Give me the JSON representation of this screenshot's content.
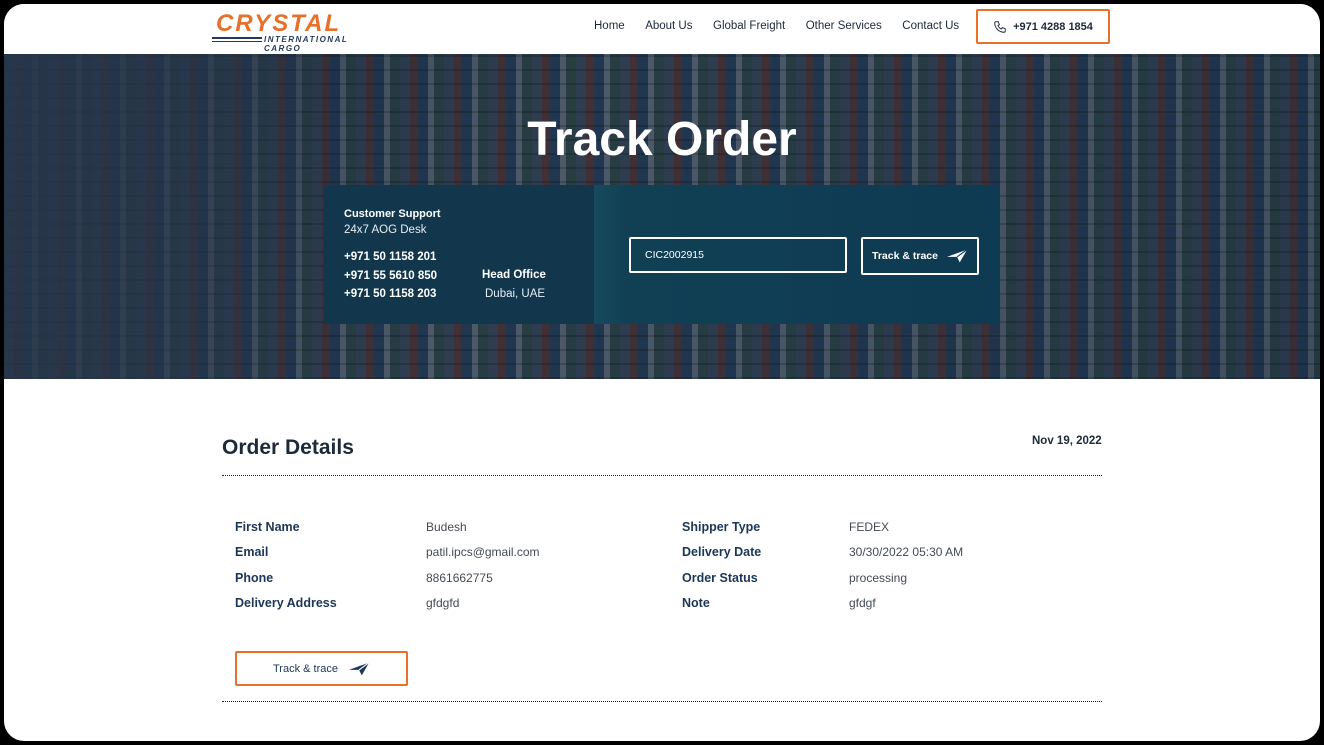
{
  "brand": {
    "name": "CRYSTAL",
    "tagline": "INTERNATIONAL CARGO",
    "accent": "#e8702a",
    "navy": "#1c3658"
  },
  "nav": {
    "items": [
      {
        "label": "Home"
      },
      {
        "label": "About Us"
      },
      {
        "label": "Global Freight"
      },
      {
        "label": "Other Services"
      },
      {
        "label": "Contact Us"
      }
    ],
    "phone_label": "+971 4288 1854",
    "phone_icon": "phone-icon"
  },
  "hero": {
    "title": "Track Order",
    "support": {
      "heading": "Customer Support",
      "subheading": "24x7 AOG Desk",
      "phones": [
        "+971 50 1158 201",
        "+971 55 5610 850",
        "+971 50 1158 203"
      ],
      "head_office_label": "Head Office",
      "head_office_value": "Dubai, UAE"
    },
    "track": {
      "input_value": "CIC2002915",
      "button_label": "Track & trace",
      "button_icon": "paper-plane-icon"
    }
  },
  "order": {
    "title": "Order Details",
    "date": "Nov 19, 2022",
    "left_fields": [
      {
        "label": "First Name",
        "value": "Budesh"
      },
      {
        "label": "Email",
        "value": "patil.ipcs@gmail.com"
      },
      {
        "label": "Phone",
        "value": "8861662775"
      },
      {
        "label": "Delivery Address",
        "value": "gfdgfd"
      }
    ],
    "right_fields": [
      {
        "label": "Shipper Type",
        "value": "FEDEX"
      },
      {
        "label": "Delivery Date",
        "value": "30/30/2022 05:30 AM"
      },
      {
        "label": "Order Status",
        "value": "processing"
      },
      {
        "label": "Note",
        "value": "gfdgf"
      }
    ],
    "track_button_label": "Track & trace"
  }
}
